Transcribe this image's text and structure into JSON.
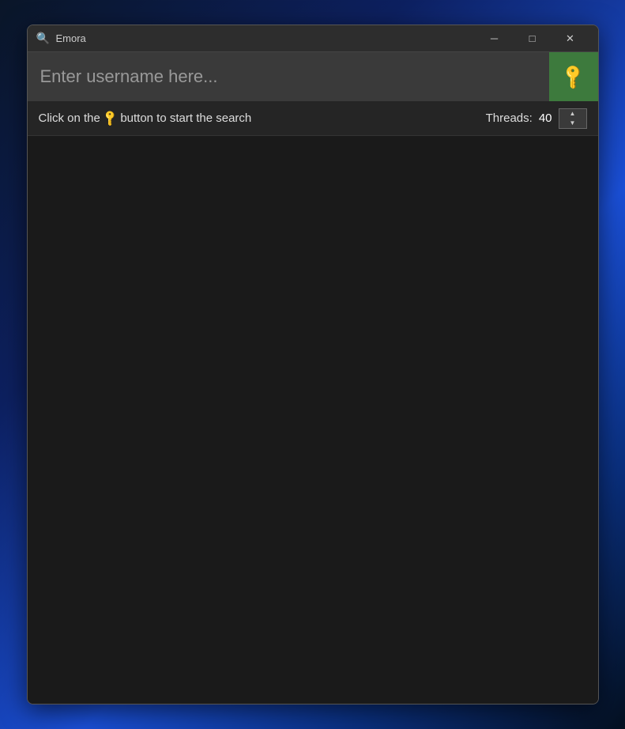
{
  "window": {
    "title": "Emora",
    "title_icon": "🔍"
  },
  "titlebar": {
    "minimize_label": "─",
    "maximize_label": "□",
    "close_label": "✕"
  },
  "search": {
    "placeholder": "Enter username here...",
    "button_icon": "🔑"
  },
  "toolbar": {
    "hint_prefix": "Click on the",
    "hint_icon": "🔑",
    "hint_suffix": "button to start the search",
    "threads_label": "Threads:",
    "threads_value": "40"
  },
  "colors": {
    "accent_green": "#4db84d",
    "key_green": "#90ee90",
    "search_bg": "#3a3a3a",
    "search_btn_bg": "#3d7a3d",
    "toolbar_bg": "#252525",
    "main_bg": "#1a1a1a"
  }
}
